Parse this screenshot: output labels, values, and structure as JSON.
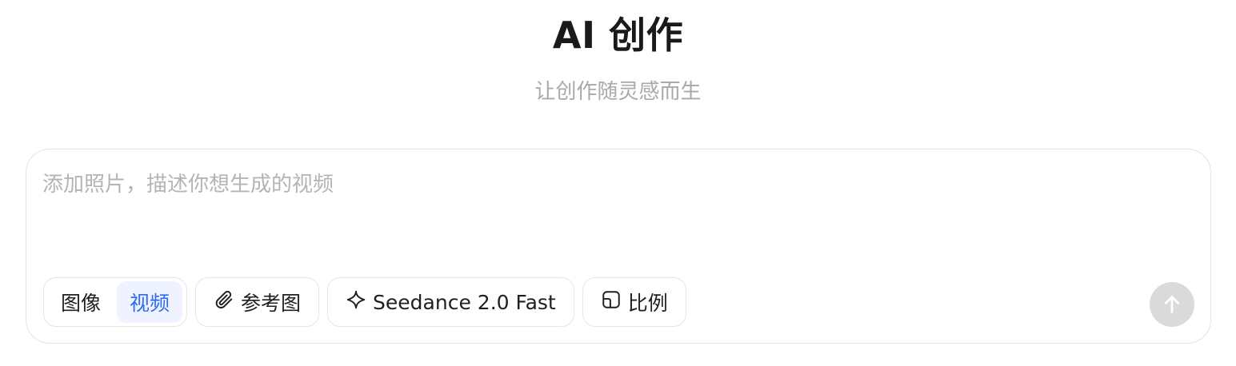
{
  "header": {
    "title": "AI 创作",
    "subtitle": "让创作随灵感而生"
  },
  "composer": {
    "placeholder": "添加照片，描述你想生成的视频",
    "mode_tabs": [
      {
        "label": "图像",
        "active": false
      },
      {
        "label": "视频",
        "active": true
      }
    ],
    "reference_label": "参考图",
    "model_label": "Seedance 2.0 Fast",
    "ratio_label": "比例",
    "send_icon": "arrow-up-icon"
  },
  "colors": {
    "accent": "#2f6bf0",
    "accent_bg": "#eef3ff",
    "send_disabled": "#dadada",
    "placeholder": "#b4b4b4"
  }
}
